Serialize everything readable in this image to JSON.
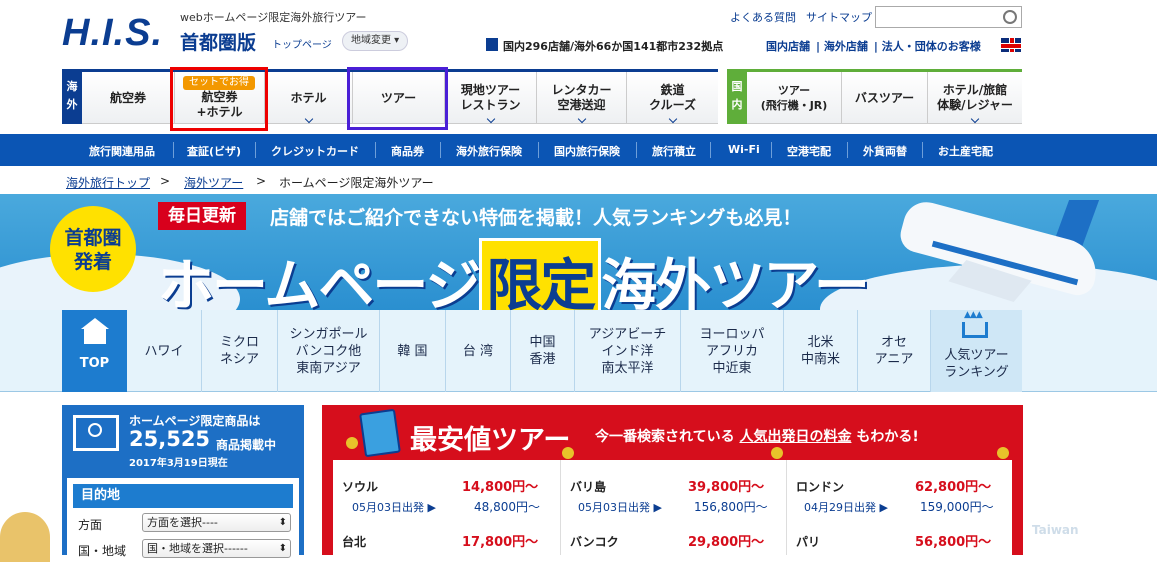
{
  "header": {
    "logo": "H.I.S.",
    "subtitle": "webホームページ限定海外旅行ツアー",
    "region": "首都圏版",
    "top_link": "トップページ",
    "region_change": "地域変更 ▾",
    "faq": "よくある質問",
    "sitemap": "サイトマップ",
    "stores": "国内296店舗/海外66か国141都市232拠点",
    "nav_links": [
      "国内店舗",
      "海外店舗",
      "法人・団体のお客様"
    ]
  },
  "main_tabs": {
    "overseas_side": "海外",
    "domestic_side": "国内",
    "set_badge": "セットでお得",
    "overseas": [
      "航空券",
      "航空券\n+ホテル",
      "ホテル",
      "ツアー",
      "現地ツアー\nレストラン",
      "レンタカー\n空港送迎",
      "鉄道\nクルーズ"
    ],
    "domestic": [
      "ツアー\n(飛行機・JR)",
      "バスツアー",
      "ホテル/旅館\n体験/レジャー"
    ]
  },
  "sub_nav": [
    "旅行関連用品",
    "査証(ビザ)",
    "クレジットカード",
    "商品券",
    "海外旅行保険",
    "国内旅行保険",
    "旅行積立",
    "Wi-Fi",
    "空港宅配",
    "外貨両替",
    "お土産宅配"
  ],
  "breadcrumb": [
    "海外旅行トップ",
    "海外ツアー",
    "ホームページ限定海外ツアー"
  ],
  "banner": {
    "circle": "首都圏\n発着",
    "daily": "毎日更新",
    "tagline": "店舗ではご紹介できない特価を掲載！人気ランキングも必見！",
    "title_a": "ホームページ",
    "title_b": "限定",
    "title_c": "海外ツアー"
  },
  "region_tabs": {
    "top": "TOP",
    "items": [
      "ハワイ",
      "ミクロ\nネシア",
      "シンガポール\nバンコク他\n東南アジア",
      "韓 国",
      "台 湾",
      "中国\n香港",
      "アジアビーチ\nインド洋\n南太平洋",
      "ヨーロッパ\nアフリカ\n中近東",
      "北米\n中南米",
      "オセ\nアニア",
      "人気ツアー\nランキング"
    ]
  },
  "left_panel": {
    "line1": "ホームページ限定商品は",
    "count": "25,525",
    "count_suffix": "商品掲載中",
    "date": "2017年3月19日現在",
    "dest_title": "目的地",
    "label_direction": "方面",
    "select_direction": "方面を選択----",
    "label_country": "国・地域",
    "select_country": "国・地域を選択------"
  },
  "cheapest": {
    "title": "最安値ツアー",
    "sub_a": "今一番検索されている",
    "sub_b": "人気出発日の料金",
    "sub_c": "もわかる!",
    "columns": [
      {
        "rows": [
          {
            "city": "ソウル",
            "price": "14,800円〜",
            "date": "05月03日出発 ▶",
            "price2": "48,800円〜"
          },
          {
            "city": "台北",
            "price": "17,800円〜",
            "date": "",
            "price2": ""
          }
        ]
      },
      {
        "rows": [
          {
            "city": "バリ島",
            "price": "39,800円〜",
            "date": "05月03日出発 ▶",
            "price2": "156,800円〜"
          },
          {
            "city": "バンコク",
            "price": "29,800円〜",
            "date": "",
            "price2": ""
          }
        ]
      },
      {
        "rows": [
          {
            "city": "ロンドン",
            "price": "62,800円〜",
            "date": "04月29日出発 ▶",
            "price2": "159,000円〜"
          },
          {
            "city": "パリ",
            "price": "56,800円〜",
            "date": "",
            "price2": ""
          }
        ]
      }
    ]
  },
  "watermark": "Taiwan",
  "colors": {
    "brand_blue": "#0b3d91",
    "sub_blue": "#0b55b4",
    "red": "#d60e1c",
    "yellow": "#ffe100",
    "green": "#5fae3a"
  }
}
